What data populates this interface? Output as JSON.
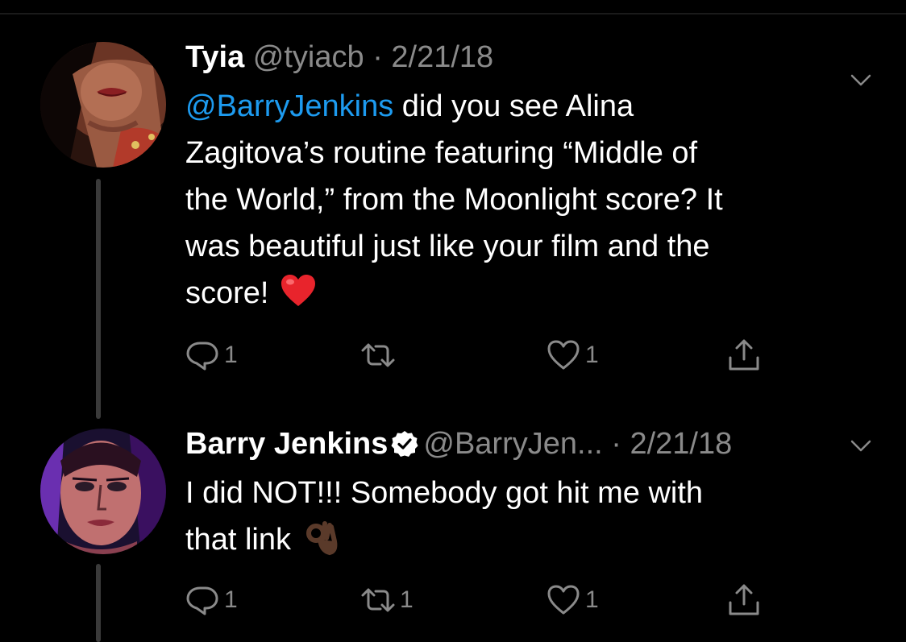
{
  "tweets": [
    {
      "display_name": "Tyia",
      "handle": "@tyiacb",
      "separator": "·",
      "date": "2/21/18",
      "mention": "@BarryJenkins",
      "text_line1": " did you see Alina",
      "text_line2": "Zagitova’s routine featuring “Middle of",
      "text_line3": "the World,” from the Moonlight score? It",
      "text_line4": "was beautiful just like your film and the",
      "text_line5": "score!",
      "emoji": "red-heart",
      "replies": "1",
      "retweets": "",
      "likes": "1",
      "verified": false
    },
    {
      "display_name": "Barry Jenkins",
      "handle": "@BarryJen...",
      "separator": "·",
      "date": "2/21/18",
      "text_line1": "I did NOT!!! Somebody got hit me with",
      "text_line2": "that link",
      "emoji": "ok-hand-dark-skin-tone",
      "replies": "1",
      "retweets": "1",
      "likes": "1",
      "verified": true
    }
  ],
  "icons": {
    "reply": "reply-icon",
    "retweet": "retweet-icon",
    "like": "heart-icon",
    "share": "share-icon",
    "more": "chevron-down-icon",
    "verified": "verified-badge-icon"
  },
  "colors": {
    "background": "#000000",
    "text": "#ffffff",
    "secondary": "#8a8a8a",
    "mention": "#1d9bf0",
    "thread_line": "#3a3a3a"
  }
}
